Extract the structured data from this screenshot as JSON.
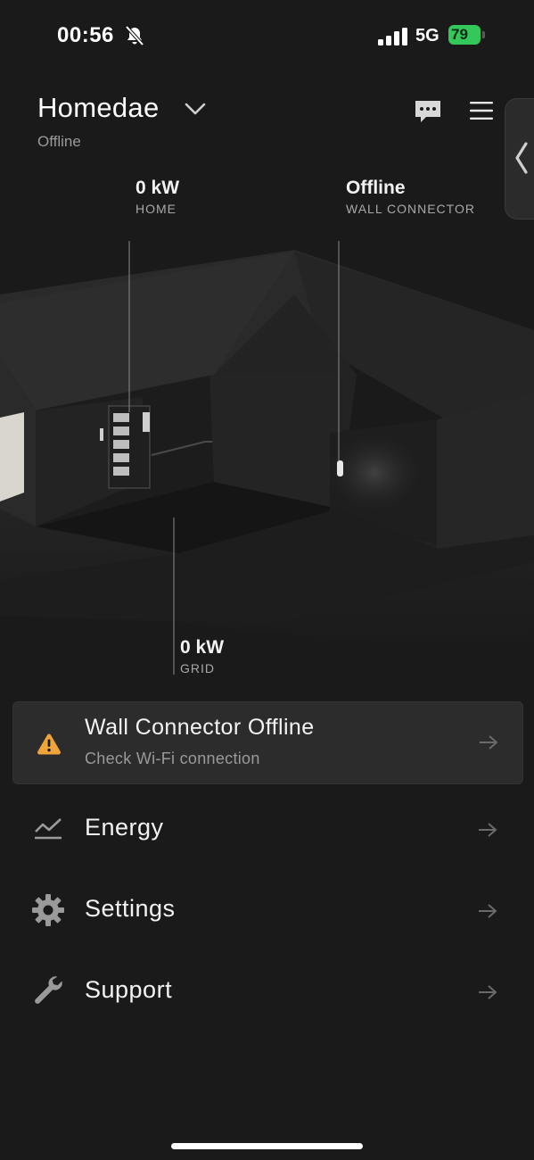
{
  "status_bar": {
    "time": "00:56",
    "network": "5G",
    "battery": "79",
    "icons": [
      "bell-slash-icon",
      "cellular-signal-icon",
      "battery-charging-icon"
    ]
  },
  "header": {
    "title": "Homedae",
    "status": "Offline",
    "icons": [
      "chevron-down-icon",
      "chat-icon",
      "hamburger-menu-icon",
      "chevron-left-icon"
    ]
  },
  "scene": {
    "home": {
      "value": "0 kW",
      "label": "HOME"
    },
    "wall_connector": {
      "value": "Offline",
      "label": "WALL CONNECTOR"
    },
    "grid": {
      "value": "0 kW",
      "label": "GRID"
    }
  },
  "alert": {
    "title": "Wall Connector Offline",
    "subtitle": "Check Wi-Fi connection",
    "icon": "warning-triangle-icon",
    "accent": "#f0a53a"
  },
  "menu": [
    {
      "label": "Energy",
      "icon": "energy-chart-icon"
    },
    {
      "label": "Settings",
      "icon": "gear-icon"
    },
    {
      "label": "Support",
      "icon": "wrench-icon"
    }
  ],
  "colors": {
    "background": "#1a1a1a",
    "card": "#2c2c2c",
    "battery": "#34c759"
  }
}
